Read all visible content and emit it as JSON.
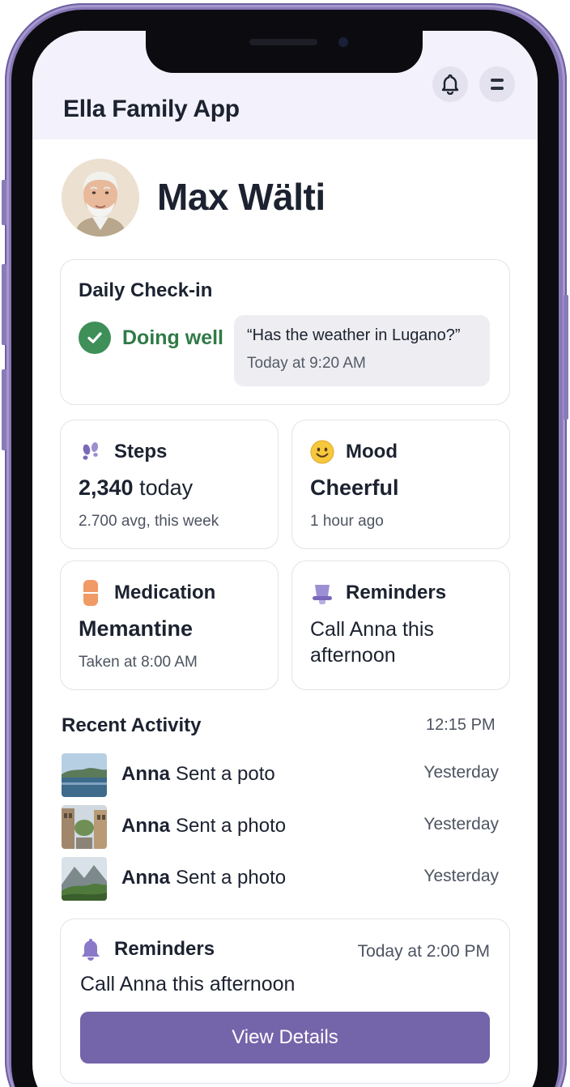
{
  "app": {
    "title": "Ella Family App"
  },
  "header": {
    "bell_icon": "bell-icon",
    "menu_icon": "menu-icon"
  },
  "profile": {
    "name": "Max Wälti"
  },
  "checkin": {
    "title": "Daily Check-in",
    "status": "Doing well",
    "quote": "“Has the weather in Lugano?”",
    "time": "Today at 9:20 AM"
  },
  "steps": {
    "title": "Steps",
    "count": "2,340",
    "unit": "today",
    "sub": "2.700 avg, this week",
    "icon": "footprints-icon"
  },
  "mood": {
    "title": "Mood",
    "value": "Cheerful",
    "sub": "1 hour ago",
    "icon": "smiley-icon"
  },
  "medication": {
    "title": "Medication",
    "value": "Memantine",
    "sub": "Taken at 8:00 AM",
    "icon": "pill-icon"
  },
  "reminders_tile": {
    "title": "Reminders",
    "text": "Call Anna this afternoon",
    "icon": "bell-icon"
  },
  "recent": {
    "title": "Recent Activity",
    "time": "12:15 PM",
    "items": [
      {
        "who": "Anna",
        "what": "Sent a poto",
        "when": "Yesterday",
        "thumb": "lake-photo"
      },
      {
        "who": "Anna",
        "what": "Sent a photo",
        "when": "Yesterday",
        "thumb": "street-photo"
      },
      {
        "who": "Anna",
        "what": "Sent a photo",
        "when": "Yesterday",
        "thumb": "mountain-photo"
      }
    ]
  },
  "reminder_card": {
    "title": "Reminders",
    "time": "Today at 2:00 PM",
    "text": "Call Anna this afternoon",
    "button": "View Details"
  },
  "colors": {
    "accent": "#7464aa",
    "success": "#2f7a47",
    "header_bg": "#f3f1fb",
    "frame": "#8878b8"
  }
}
